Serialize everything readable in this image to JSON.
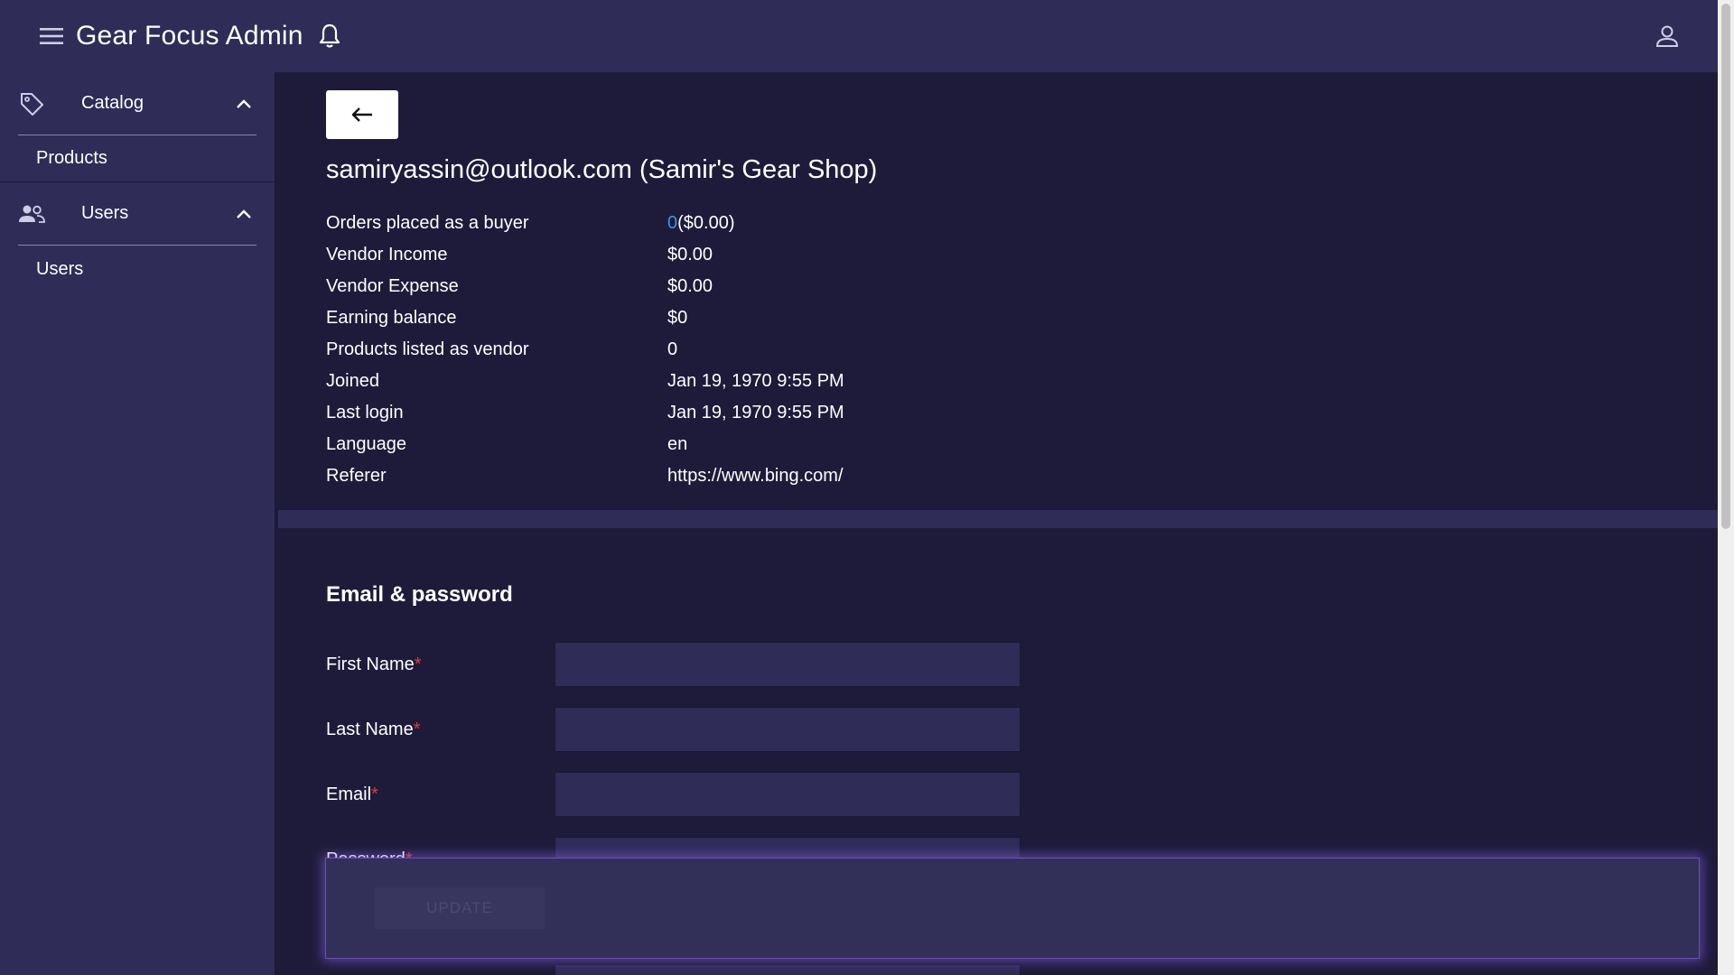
{
  "header": {
    "title": "Gear Focus Admin",
    "menu_icon": "hamburger-menu-icon",
    "notification_icon": "bell-icon",
    "account_icon": "user-account-icon"
  },
  "sidebar": {
    "groups": [
      {
        "label": "Catalog",
        "icon": "tag-icon",
        "expanded": true,
        "items": [
          {
            "label": "Products"
          }
        ]
      },
      {
        "label": "Users",
        "icon": "people-icon",
        "expanded": true,
        "items": [
          {
            "label": "Users"
          }
        ]
      }
    ]
  },
  "profile": {
    "heading": "samiryassin@outlook.com (Samir's Gear Shop)",
    "orders_link": "0",
    "rows": [
      {
        "label": "Orders placed as a buyer",
        "value": "($0.00)"
      },
      {
        "label": "Vendor Income",
        "value": "$0.00"
      },
      {
        "label": "Vendor Expense",
        "value": "$0.00"
      },
      {
        "label": "Earning balance",
        "value": "$0"
      },
      {
        "label": "Products listed as vendor",
        "value": "0"
      },
      {
        "label": "Joined",
        "value": "Jan 19, 1970 9:55 PM"
      },
      {
        "label": "Last login",
        "value": "Jan 19, 1970 9:55 PM"
      },
      {
        "label": "Language",
        "value": "en"
      },
      {
        "label": "Referer",
        "value": "https://www.bing.com/"
      }
    ]
  },
  "form": {
    "section_title": "Email & password",
    "required_mark": "*",
    "fields": [
      {
        "label": "First Name",
        "value": ""
      },
      {
        "label": "Last Name",
        "value": ""
      },
      {
        "label": "Email",
        "value": ""
      },
      {
        "label": "Password",
        "value": ""
      }
    ],
    "update_label": "UPDATE"
  },
  "colors": {
    "background": "#1e1b3a",
    "panel": "#2f2c57",
    "link": "#4a8fe8",
    "required": "#e53935",
    "glow": "#8a5ae6"
  }
}
